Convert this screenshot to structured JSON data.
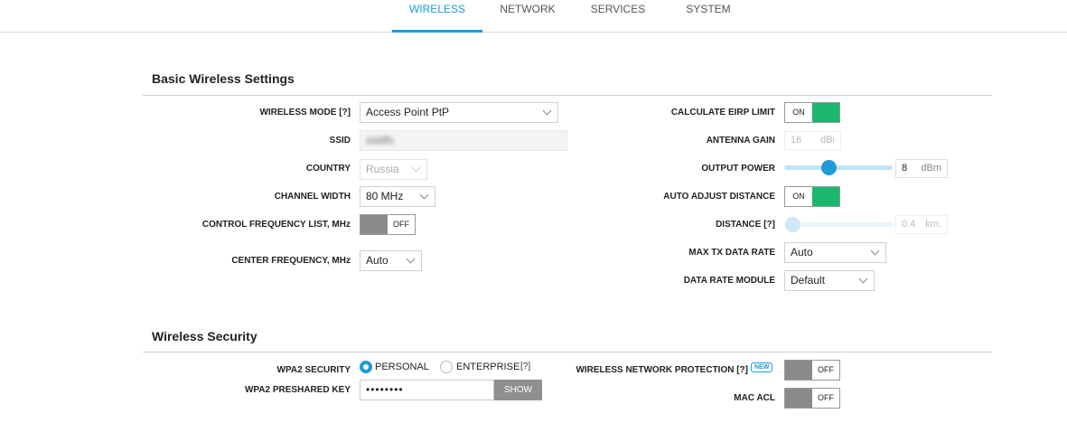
{
  "nav": {
    "tabs": [
      {
        "label": "WIRELESS",
        "active": true
      },
      {
        "label": "NETWORK",
        "active": false
      },
      {
        "label": "SERVICES",
        "active": false
      },
      {
        "label": "SYSTEM",
        "active": false
      }
    ]
  },
  "basic": {
    "title": "Basic Wireless Settings",
    "wireless_mode": {
      "label": "WIRELESS MODE [?]",
      "value": "Access Point PtP"
    },
    "ssid": {
      "label": "SSID",
      "value": "ssidfs"
    },
    "country": {
      "label": "COUNTRY",
      "value": "Russia"
    },
    "channel_width": {
      "label": "CHANNEL WIDTH",
      "value": "80 MHz"
    },
    "control_freq": {
      "label": "CONTROL FREQUENCY LIST, MHz",
      "state": "OFF"
    },
    "center_freq": {
      "label": "CENTER FREQUENCY, MHz",
      "value": "Auto"
    },
    "eirp": {
      "label": "CALCULATE EIRP LIMIT",
      "state": "ON"
    },
    "antenna_gain": {
      "label": "ANTENNA GAIN",
      "value": "16",
      "unit": "dBi"
    },
    "output_power": {
      "label": "OUTPUT POWER",
      "value": "8",
      "unit": "dBm",
      "level": 0.41
    },
    "auto_distance": {
      "label": "AUTO ADJUST DISTANCE",
      "state": "ON"
    },
    "distance": {
      "label": "DISTANCE [?]",
      "value": "0.4",
      "unit": "km.",
      "level": 0.0
    },
    "max_tx": {
      "label": "MAX TX DATA RATE",
      "value": "Auto"
    },
    "rate_module": {
      "label": "DATA RATE MODULE",
      "value": "Default"
    }
  },
  "security": {
    "title": "Wireless Security",
    "wpa2": {
      "label": "WPA2 SECURITY",
      "personal": "PERSONAL",
      "enterprise": "ENTERPRISE",
      "help": "[?]",
      "selected": "PERSONAL"
    },
    "psk": {
      "label": "WPA2 PRESHARED KEY",
      "value": "••••••••",
      "show_label": "SHOW"
    },
    "protection": {
      "label": "WIRELESS NETWORK PROTECTION [?]",
      "badge": "NEW",
      "state": "OFF"
    },
    "mac_acl": {
      "label": "MAC ACL",
      "state": "OFF"
    }
  },
  "colors": {
    "accent": "#1e9bd7",
    "on": "#1bb76e",
    "off": "#8a8a8a"
  }
}
